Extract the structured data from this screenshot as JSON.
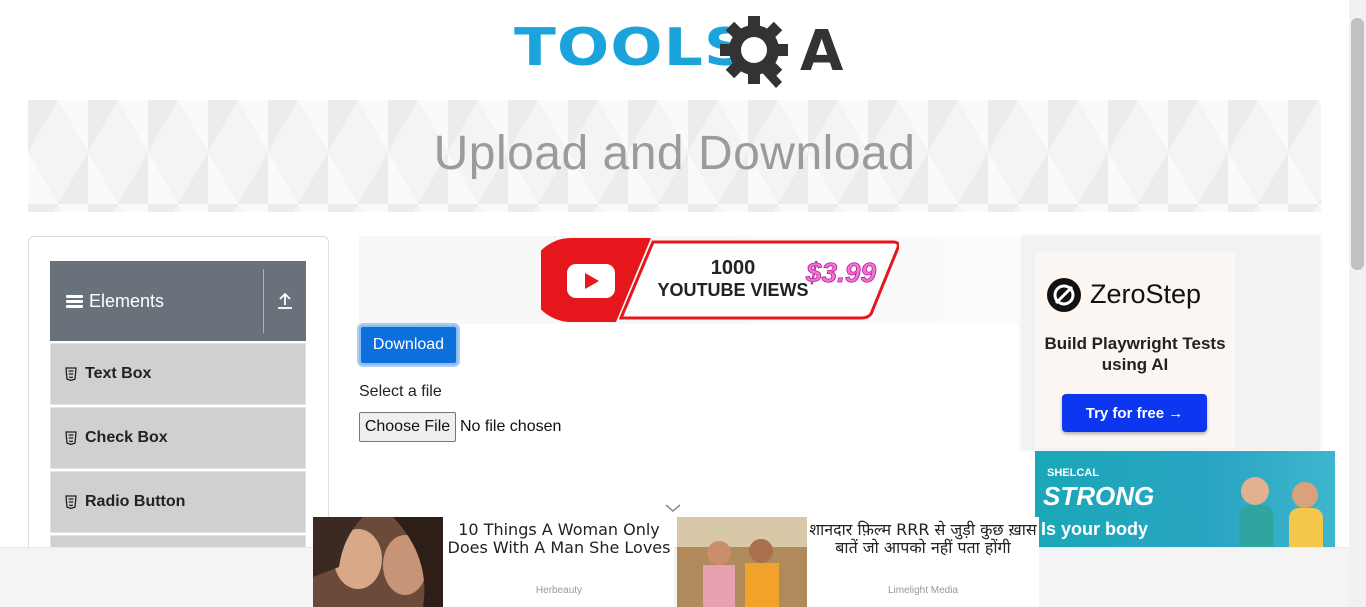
{
  "header": {
    "logo_text": "TOOLS",
    "logo_suffix": "A"
  },
  "banner": {
    "title": "Upload and Download"
  },
  "sidebar": {
    "group_title": "Elements",
    "items": [
      {
        "label": "Text Box"
      },
      {
        "label": "Check Box"
      },
      {
        "label": "Radio Button"
      }
    ]
  },
  "main": {
    "ad_top": {
      "line1": "1000",
      "line2": "YOUTUBE VIEWS",
      "price": "$3.99"
    },
    "download_label": "Download",
    "select_file_label": "Select a file",
    "choose_file_label": "Choose File",
    "file_status": "No file chosen"
  },
  "right_ads": {
    "zerostep": {
      "brand": "ZeroStep",
      "text": "Build Playwright Tests using AI",
      "cta": "Try for free →"
    },
    "shelcal": {
      "small": "SHELCAL",
      "big": "STRONG",
      "line": "Is your body"
    }
  },
  "bottom_ads": [
    {
      "title": "10 Things A Woman Only Does With A Man She Loves",
      "source": "Herbeauty"
    },
    {
      "title": "शानदार फ़िल्म RRR से जुड़ी कुछ ख़ास बातें जो आपको नहीं पता होंगी",
      "source": "Limelight Media"
    }
  ],
  "colors": {
    "accent": "#0c6fdb",
    "group_header": "#69727a",
    "logo_blue": "#1ba3db"
  }
}
